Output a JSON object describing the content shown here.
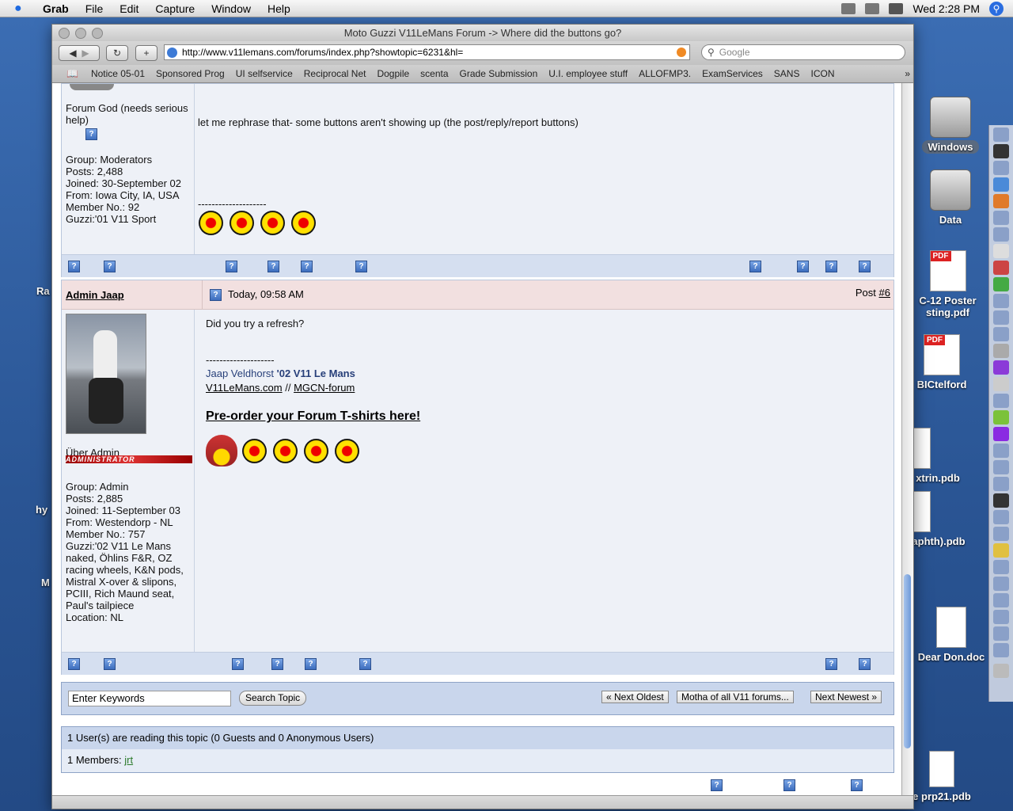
{
  "menubar": {
    "apple": "",
    "app": "Grab",
    "items": [
      "File",
      "Edit",
      "Capture",
      "Window",
      "Help"
    ],
    "clock": "Wed 2:28 PM"
  },
  "desktop": {
    "icons": {
      "windows": "Windows",
      "data": "Data",
      "pdf1_line1": "C-12 Poster",
      "pdf1_line2": "sting.pdf",
      "pdf2": "BICtelford",
      "pdb1": "xtrin.pdb",
      "pdb2": "aphth).pdb",
      "doc": "Dear Don.doc",
      "pdb3": "e prp21.pdb",
      "left1": "Ra",
      "left2": "hy",
      "left3": "M"
    }
  },
  "browser": {
    "title": "Moto Guzzi V11LeMans Forum -> Where did the buttons go?",
    "url": "http://www.v11lemans.com/forums/index.php?showtopic=6231&hl=",
    "search_placeholder": "Google",
    "bookmarks": [
      "Notice 05-01",
      "Sponsored Prog",
      "UI selfservice",
      "Reciprocal Net",
      "Dogpile",
      "scenta",
      "Grade Submission",
      "U.I. employee stuff",
      "ALLOFMP3.",
      "ExamServices",
      "SANS",
      "ICON"
    ]
  },
  "post5": {
    "user_title_line1": "Forum God (needs serious",
    "user_title_line2": "help)",
    "group": "Group: Moderators",
    "posts": "Posts: 2,488",
    "joined": "Joined: 30-September 02",
    "from": "From: Iowa City, IA, USA",
    "member_no": "Member No.: 92",
    "guzzi": "Guzzi:'01 V11 Sport",
    "body": "let me rephrase that- some buttons aren't showing up (the post/reply/report buttons)",
    "signature_rule": "--------------------"
  },
  "post6": {
    "author": "Admin Jaap",
    "date": "Today, 09:58 AM",
    "post_label": "Post",
    "post_num": "#6",
    "user_title": "Über Admin",
    "admin_banner": "ADMINISTRATOR",
    "group": "Group: Admin",
    "posts": "Posts: 2,885",
    "joined": "Joined: 11-September 03",
    "from": "From: Westendorp - NL",
    "member_no": "Member No.: 757",
    "guzzi_lines": [
      "Guzzi:'02 V11 Le Mans",
      "naked, Öhlins F&R, OZ",
      "racing wheels, K&N pods,",
      "Mistral X-over & slipons,",
      "PCIII, Rich Maund seat,",
      "Paul's tailpiece"
    ],
    "location": "Location: NL",
    "body": "Did you try a refresh?",
    "signature_rule": "--------------------",
    "sig_name": "Jaap Veldhorst",
    "sig_bike": "'02 V11 Le Mans",
    "sig_link1": "V11LeMans.com",
    "sig_sep": "//",
    "sig_link2": "MGCN-forum",
    "preorder": "Pre-order your Forum T-shirts here!"
  },
  "icon_glyph": "?",
  "bottom": {
    "keywords": "Enter Keywords",
    "search_btn": "Search Topic",
    "next_oldest": "« Next Oldest",
    "forum_name": "Motha of all V11 forums...",
    "next_newest": "Next Newest »",
    "readers": "1 User(s) are reading this topic (0 Guests and 0 Anonymous Users)",
    "members_label": "1 Members:",
    "member": "jrt"
  }
}
